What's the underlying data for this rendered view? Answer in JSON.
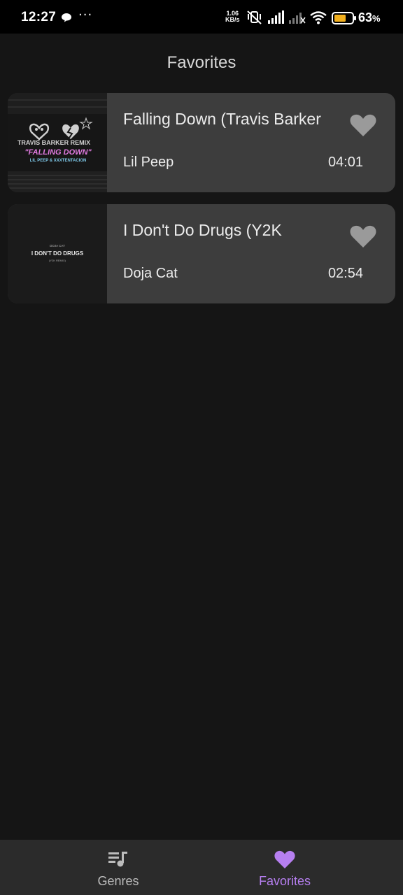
{
  "status_bar": {
    "time": "12:27",
    "speed_value": "1.06",
    "speed_unit": "KB/s",
    "battery_percent": "63",
    "battery_symbol": "%"
  },
  "header": {
    "title": "Favorites"
  },
  "favorites": [
    {
      "title": "Falling Down (Travis Barker",
      "artist": "Lil Peep",
      "duration": "04:01",
      "cover_text": [
        "TRAVIS BARKER REMIX",
        "\"FALLING DOWN\"",
        "LIL PEEP & XXXTENTACION"
      ]
    },
    {
      "title": "I Don't Do Drugs (Y2K",
      "artist": "Doja Cat",
      "duration": "02:54",
      "cover_text": [
        "DOJA CAT",
        "I DON'T DO DRUGS",
        "(Y2K REMIX)"
      ]
    }
  ],
  "bottom_nav": {
    "genres_label": "Genres",
    "favorites_label": "Favorites"
  },
  "colors": {
    "accent": "#b67ff0",
    "card_bg": "#3d3d3d",
    "page_bg": "#151515",
    "heart_icon": "#9a9a9a"
  }
}
